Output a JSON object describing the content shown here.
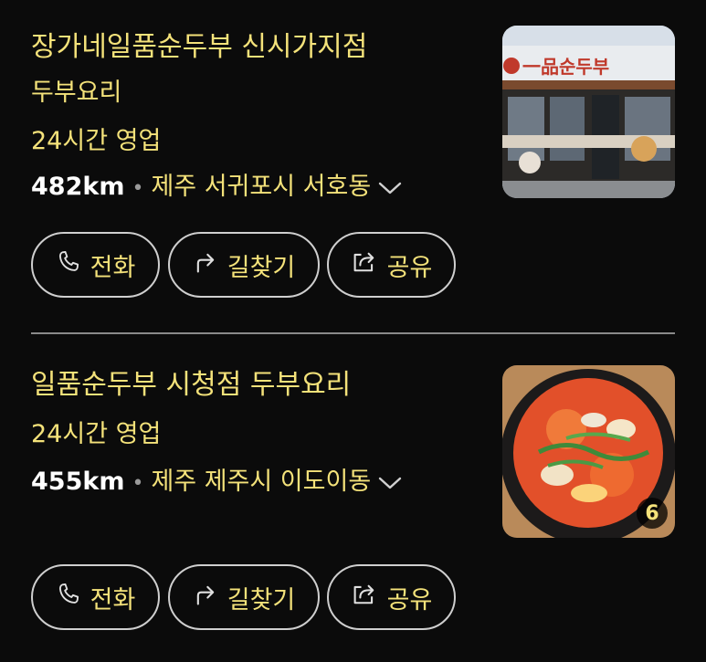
{
  "places": [
    {
      "name": "장가네일품순두부 신시가지점",
      "category": "두부요리",
      "hours": "24시간 영업",
      "distance": "482km",
      "address": "제주 서귀포시 서호동",
      "sign_text": "一品순두부",
      "buttons": {
        "call": "전화",
        "directions": "길찾기",
        "share": "공유"
      }
    },
    {
      "name": "일품순두부 시청점 두부요리",
      "hours": "24시간 영업",
      "distance": "455km",
      "address": "제주 제주시 이도이동",
      "photo_count": "6",
      "buttons": {
        "call": "전화",
        "directions": "길찾기",
        "share": "공유"
      }
    }
  ],
  "colors": {
    "accent": "#f4e27a",
    "background": "#0b0b0b",
    "border": "#cfcfcf"
  },
  "icons": [
    "phone-icon",
    "directions-arrow-icon",
    "share-icon",
    "chevron-down-icon"
  ]
}
